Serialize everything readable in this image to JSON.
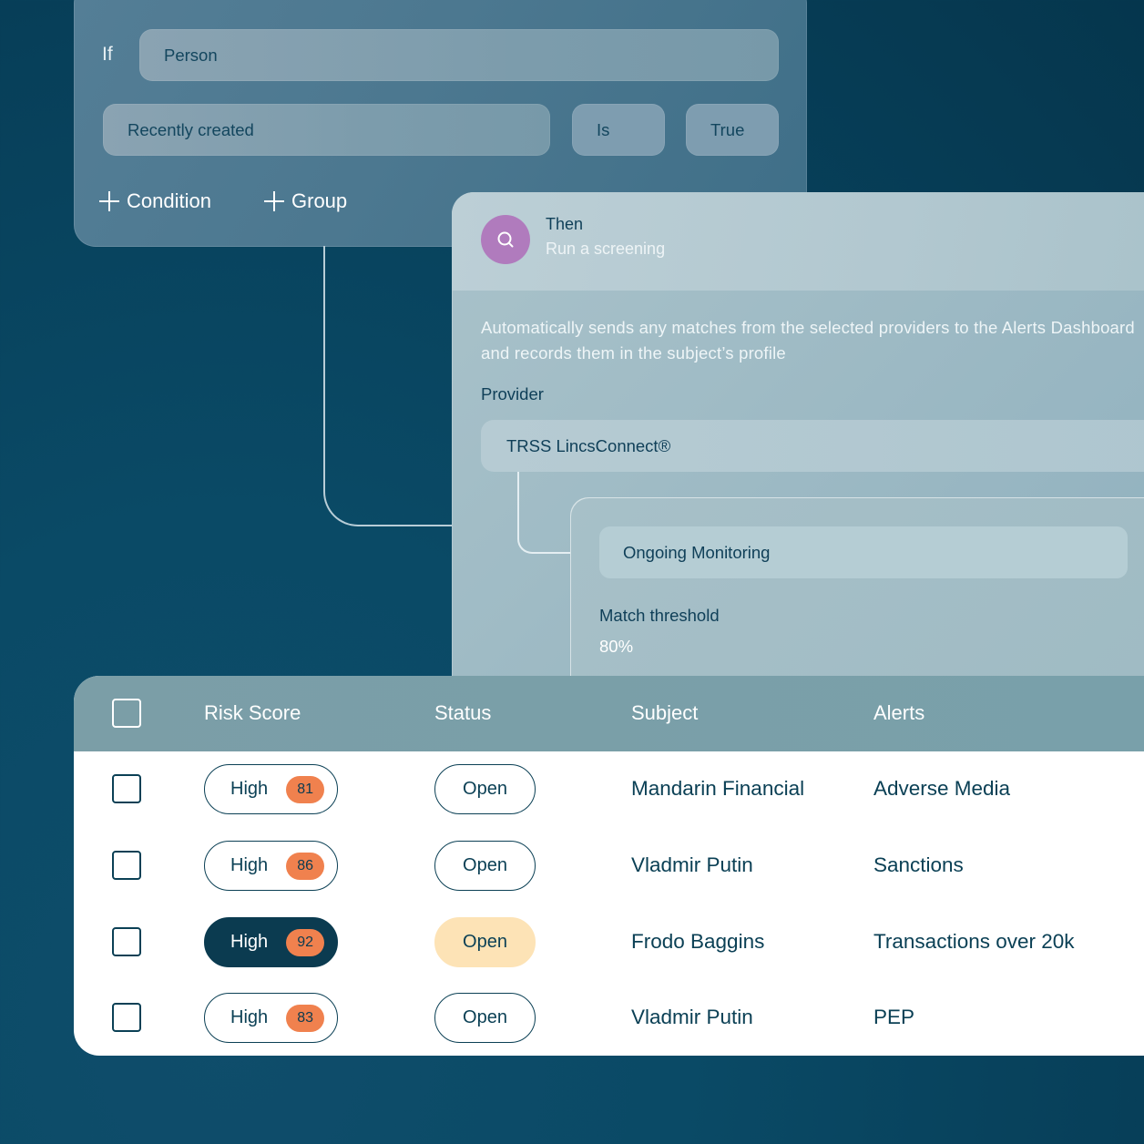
{
  "rule": {
    "if_label": "If",
    "entity_field": "Person",
    "condition_field": "Recently created",
    "operator_field": "Is",
    "value_field": "True",
    "add_condition_label": "Condition",
    "add_group_label": "Group"
  },
  "action": {
    "title": "Then",
    "subtitle": "Run a screening",
    "icon": "search-icon",
    "description": "Automatically sends any matches from the selected providers to the Alerts Dashboard and records them in the subject’s profile",
    "provider_label": "Provider",
    "provider_value": "TRSS LincsConnect®",
    "monitoring_value": "Ongoing Monitoring",
    "threshold_label": "Match threshold",
    "threshold_value": "80%"
  },
  "table": {
    "columns": [
      "Risk Score",
      "Status",
      "Subject",
      "Alerts"
    ],
    "rows": [
      {
        "risk": "High",
        "score": "81",
        "status": "Open",
        "subject": "Mandarin Financial",
        "alert": "Adverse Media"
      },
      {
        "risk": "High",
        "score": "86",
        "status": "Open",
        "subject": "Vladmir Putin",
        "alert": "Sanctions"
      },
      {
        "risk": "High",
        "score": "92",
        "status": "Open",
        "subject": "Frodo Baggins",
        "alert": "Transactions over 20k"
      },
      {
        "risk": "High",
        "score": "83",
        "status": "Open",
        "subject": "Vladmir Putin",
        "alert": "PEP"
      }
    ]
  },
  "colors": {
    "background": "#073f59",
    "accent_dark": "#0b3b50",
    "score_badge": "#f0814e",
    "status_highlight": "#fde3b6",
    "screening_icon": "#b07bbd"
  }
}
